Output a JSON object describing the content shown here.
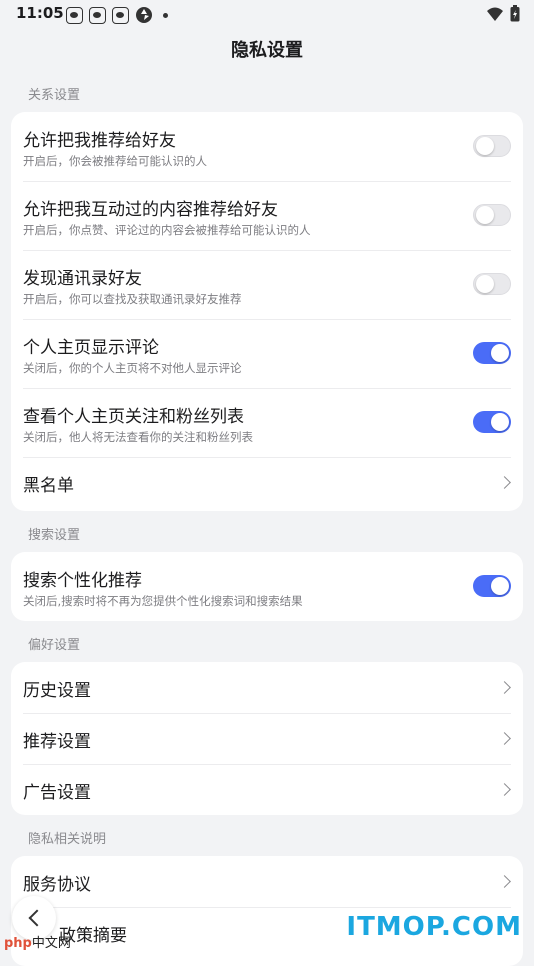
{
  "status": {
    "time": "11:05",
    "icons": [
      "paw-icon",
      "paw-icon",
      "paw-icon",
      "shutter-icon",
      "dot-icon"
    ],
    "right_icons": [
      "wifi-icon",
      "battery-icon"
    ]
  },
  "page": {
    "title": "隐私设置"
  },
  "sections": {
    "relations": {
      "label": "关系设置",
      "items": [
        {
          "title": "允许把我推荐给好友",
          "desc": "开启后，你会被推荐给可能认识的人",
          "toggle": "off"
        },
        {
          "title": "允许把我互动过的内容推荐给好友",
          "desc": "开启后，你点赞、评论过的内容会被推荐给可能认识的人",
          "toggle": "off"
        },
        {
          "title": "发现通讯录好友",
          "desc": "开启后，你可以查找及获取通讯录好友推荐",
          "toggle": "off"
        },
        {
          "title": "个人主页显示评论",
          "desc": "关闭后，你的个人主页将不对他人显示评论",
          "toggle": "on"
        },
        {
          "title": "查看个人主页关注和粉丝列表",
          "desc": "关闭后，他人将无法查看你的关注和粉丝列表",
          "toggle": "on"
        },
        {
          "title": "黑名单"
        }
      ]
    },
    "search": {
      "label": "搜索设置",
      "items": [
        {
          "title": "搜索个性化推荐",
          "desc": "关闭后,搜索时将不再为您提供个性化搜索词和搜索结果",
          "toggle": "on"
        }
      ]
    },
    "preferences": {
      "label": "偏好设置",
      "items": [
        {
          "title": "历史设置"
        },
        {
          "title": "推荐设置"
        },
        {
          "title": "广告设置"
        }
      ]
    },
    "privacy_notes": {
      "label": "隐私相关说明",
      "items": [
        {
          "title": "服务协议"
        },
        {
          "title": "政策摘要"
        }
      ]
    }
  },
  "watermark": {
    "left_brand": "php",
    "left_text": "中文网",
    "right": "ITMOP.COM"
  },
  "colors": {
    "accent": "#4a6cf7",
    "background": "#f2f3f5",
    "watermark_blue": "#1ba7e0",
    "watermark_red": "#e0523a"
  }
}
